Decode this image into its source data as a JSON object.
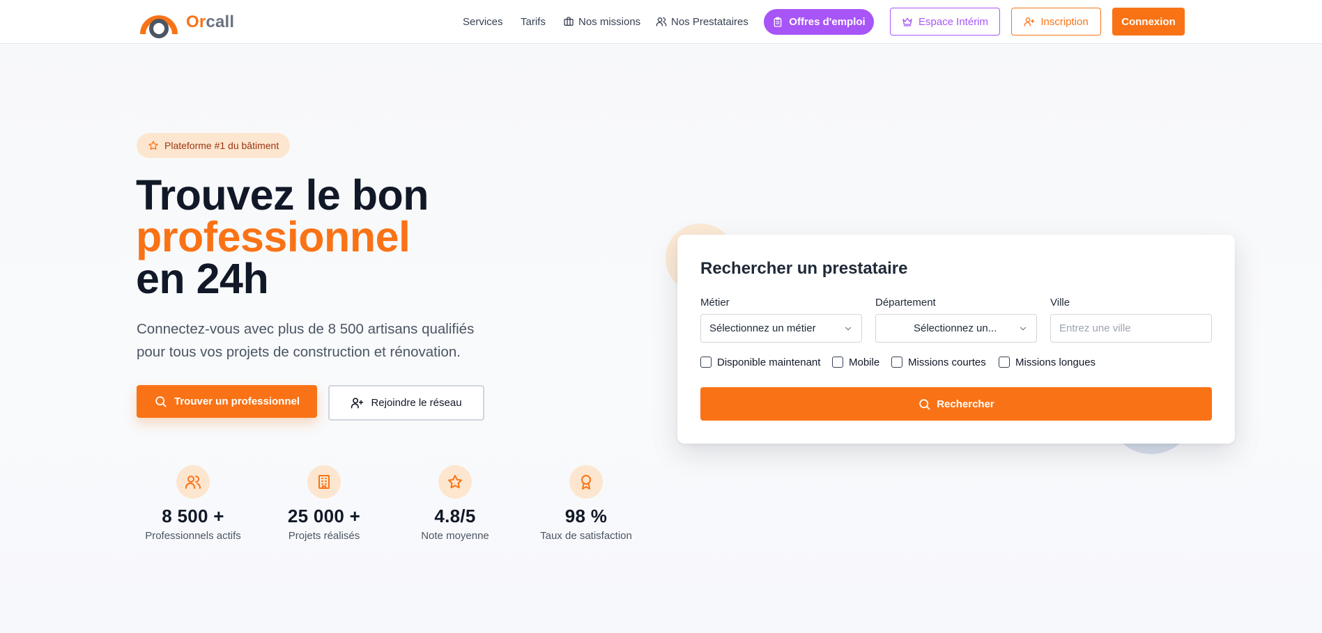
{
  "brand": {
    "logo_prefix": "Or",
    "logo_suffix": "call",
    "accent_color": "#f97316",
    "purple_color": "#a855f7"
  },
  "nav": {
    "services": "Services",
    "tarifs": "Tarifs",
    "missions": "Nos missions",
    "prestataires": "Nos Prestataires",
    "jobs": "Offres d'emploi",
    "interim": "Espace Intérim",
    "inscription": "Inscription",
    "connexion": "Connexion"
  },
  "hero": {
    "badge": "Plateforme #1 du bâtiment",
    "title_line1": "Trouvez le bon",
    "title_line2": "professionnel",
    "title_line3": "en 24h",
    "subtitle_line1": "Connectez-vous avec plus de 8 500 artisans qualifiés",
    "subtitle_line2": "pour tous vos projets de construction et rénovation.",
    "cta_find": "Trouver un professionnel",
    "cta_join": "Rejoindre le réseau"
  },
  "stats": [
    {
      "icon": "users-icon",
      "value": "8 500 +",
      "label": "Professionnels actifs"
    },
    {
      "icon": "building-icon",
      "value": "25 000 +",
      "label": "Projets réalisés"
    },
    {
      "icon": "star-icon",
      "value": "4.8/5",
      "label": "Note moyenne"
    },
    {
      "icon": "award-icon",
      "value": "98 %",
      "label": "Taux de satisfaction"
    }
  ],
  "search": {
    "title": "Rechercher un prestataire",
    "metier_label": "Métier",
    "metier_value": "Sélectionnez un métier",
    "departement_label": "Département",
    "departement_value": "Sélectionnez un...",
    "ville_label": "Ville",
    "ville_placeholder": "Entrez une ville",
    "filters": [
      "Disponible maintenant",
      "Mobile",
      "Missions courtes",
      "Missions longues"
    ],
    "button": "Rechercher"
  }
}
